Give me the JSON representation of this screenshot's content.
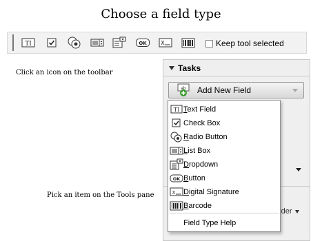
{
  "title": "Choose a field type",
  "toolbar": {
    "buttons": [
      {
        "name": "text-field-tool",
        "icon": "text-field-icon"
      },
      {
        "name": "check-box-tool",
        "icon": "check-box-icon"
      },
      {
        "name": "radio-button-tool",
        "icon": "radio-button-icon"
      },
      {
        "name": "list-box-tool",
        "icon": "list-box-icon"
      },
      {
        "name": "dropdown-tool",
        "icon": "dropdown-icon"
      },
      {
        "name": "button-tool",
        "icon": "button-icon"
      },
      {
        "name": "digital-signature-tool",
        "icon": "digital-signature-icon"
      },
      {
        "name": "barcode-tool",
        "icon": "barcode-icon"
      }
    ],
    "keep_tool_label": "Keep tool selected",
    "keep_tool_checked": false
  },
  "captions": {
    "toolbar": "Click  an icon on the toolbar",
    "tools_pane": "Pick an item on the Tools  pane"
  },
  "pane": {
    "header": "Tasks",
    "add_field_label": "Add New Field",
    "order_label": "rder"
  },
  "menu": {
    "items": [
      {
        "mnemonic": "T",
        "rest": "ext Field",
        "icon": "text-field-icon"
      },
      {
        "mnemonic": "",
        "rest": "Check Box",
        "icon": "check-box-icon"
      },
      {
        "mnemonic": "R",
        "rest": "adio Button",
        "icon": "radio-button-icon"
      },
      {
        "mnemonic": "L",
        "rest": "ist Box",
        "icon": "list-box-icon"
      },
      {
        "mnemonic": "D",
        "rest": "ropdown",
        "icon": "dropdown-icon"
      },
      {
        "mnemonic": "B",
        "rest": "utton",
        "icon": "button-icon"
      },
      {
        "mnemonic": "D",
        "rest": "igital Signature",
        "icon": "digital-signature-icon"
      },
      {
        "mnemonic": "B",
        "rest": "arcode",
        "icon": "barcode-icon"
      }
    ],
    "help": "Field Type Help",
    "check_box_underline_char": "k"
  },
  "icon_text": {
    "text_field": "TI",
    "button": "OK",
    "signature": "X",
    "add_field": "ab"
  },
  "colors": {
    "add_field_green": "#3a9d2e",
    "pane_bg": "#efefef",
    "toolbar_bg": "#f2f2f2"
  }
}
